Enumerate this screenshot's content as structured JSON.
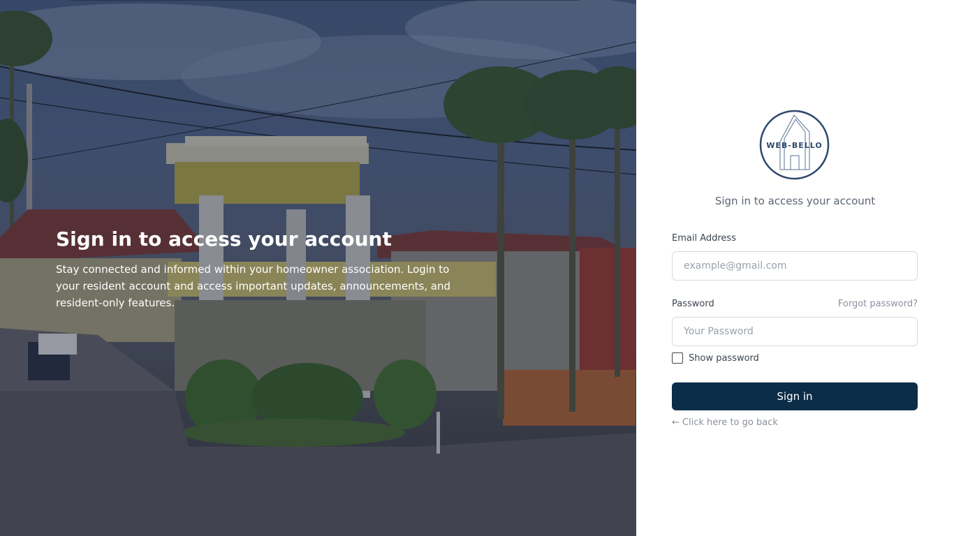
{
  "hero": {
    "title": "Sign in to access your account",
    "subtitle": "Stay connected and informed within your homeowner association. Login to your resident account and access important updates, announcements, and resident-only features.",
    "image_icon": "subdivision-gate-photo"
  },
  "logo": {
    "text": "WEB-BELLO",
    "icon": "house-outline-icon",
    "color": "#2d4a6b"
  },
  "form": {
    "subtitle": "Sign in to access your account",
    "email_label": "Email Address",
    "email_placeholder": "example@gmail.com",
    "email_value": "",
    "password_label": "Password",
    "password_placeholder": "Your Password",
    "password_value": "",
    "forgot_label": "Forgot password?",
    "show_password_label": "Show password",
    "show_password_checked": false,
    "signin_label": "Sign in",
    "back_icon": "arrow-left-icon",
    "back_arrow": "←",
    "back_label": "Click here to go back"
  },
  "colors": {
    "primary": "#0c2d48",
    "muted_text": "#8b939d",
    "logo_blue": "#2d4a6b"
  }
}
